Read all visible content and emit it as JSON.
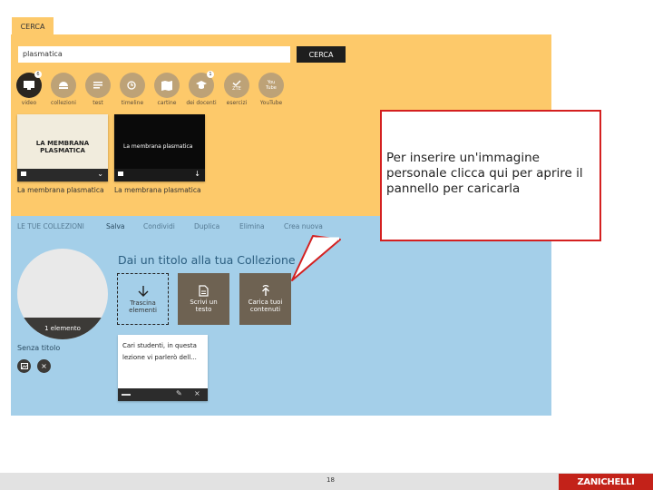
{
  "search": {
    "tab_label": "CERCA",
    "query": "plasmatica",
    "button_label": "CERCA"
  },
  "categories": [
    {
      "label": "video",
      "icon": "video-icon",
      "active": true,
      "badge": "6"
    },
    {
      "label": "collezioni",
      "icon": "collection-icon",
      "active": false
    },
    {
      "label": "test",
      "icon": "test-icon",
      "active": false
    },
    {
      "label": "timeline",
      "icon": "timeline-icon",
      "active": false
    },
    {
      "label": "cartine",
      "icon": "map-icon",
      "active": false
    },
    {
      "label": "dei docenti",
      "icon": "teacher-icon",
      "active": false,
      "badge": "1"
    },
    {
      "label": "esercizi",
      "icon": "exercise-icon",
      "active": false,
      "icon_text": "ZTE"
    },
    {
      "label": "YouTube",
      "icon": "youtube-icon",
      "active": false,
      "icon_text": "You Tube"
    }
  ],
  "results": [
    {
      "thumb_title": "LA MEMBRANA PLASMATICA",
      "caption": "La membrana plasmatica"
    },
    {
      "thumb_title": "La membrana plasmatica",
      "caption": "La membrana plasmatica"
    }
  ],
  "collections": {
    "tabs": [
      "LE TUE COLLEZIONI",
      "Salva",
      "Condividi",
      "Duplica",
      "Elimina",
      "Crea nuova"
    ],
    "cover_count": "1 elemento",
    "name": "Senza titolo",
    "title_placeholder": "Dai un titolo alla tua Collezione",
    "boxes": [
      "Trascina elementi",
      "Scrivi un testo",
      "Carica tuoi contenuti"
    ],
    "note_text": "Cari studenti, in questa lezione vi parlerò dell..."
  },
  "callout": {
    "text": "Per inserire un'immagine personale clicca qui per aprire il pannello per caricarla"
  },
  "footer": {
    "page_number": "18",
    "brand": "ZANICHELLI"
  },
  "colors": {
    "yellow_panel": "#fdc96a",
    "blue_panel": "#a4cfe9",
    "callout_border": "#d42020",
    "brand": "#c32219"
  }
}
